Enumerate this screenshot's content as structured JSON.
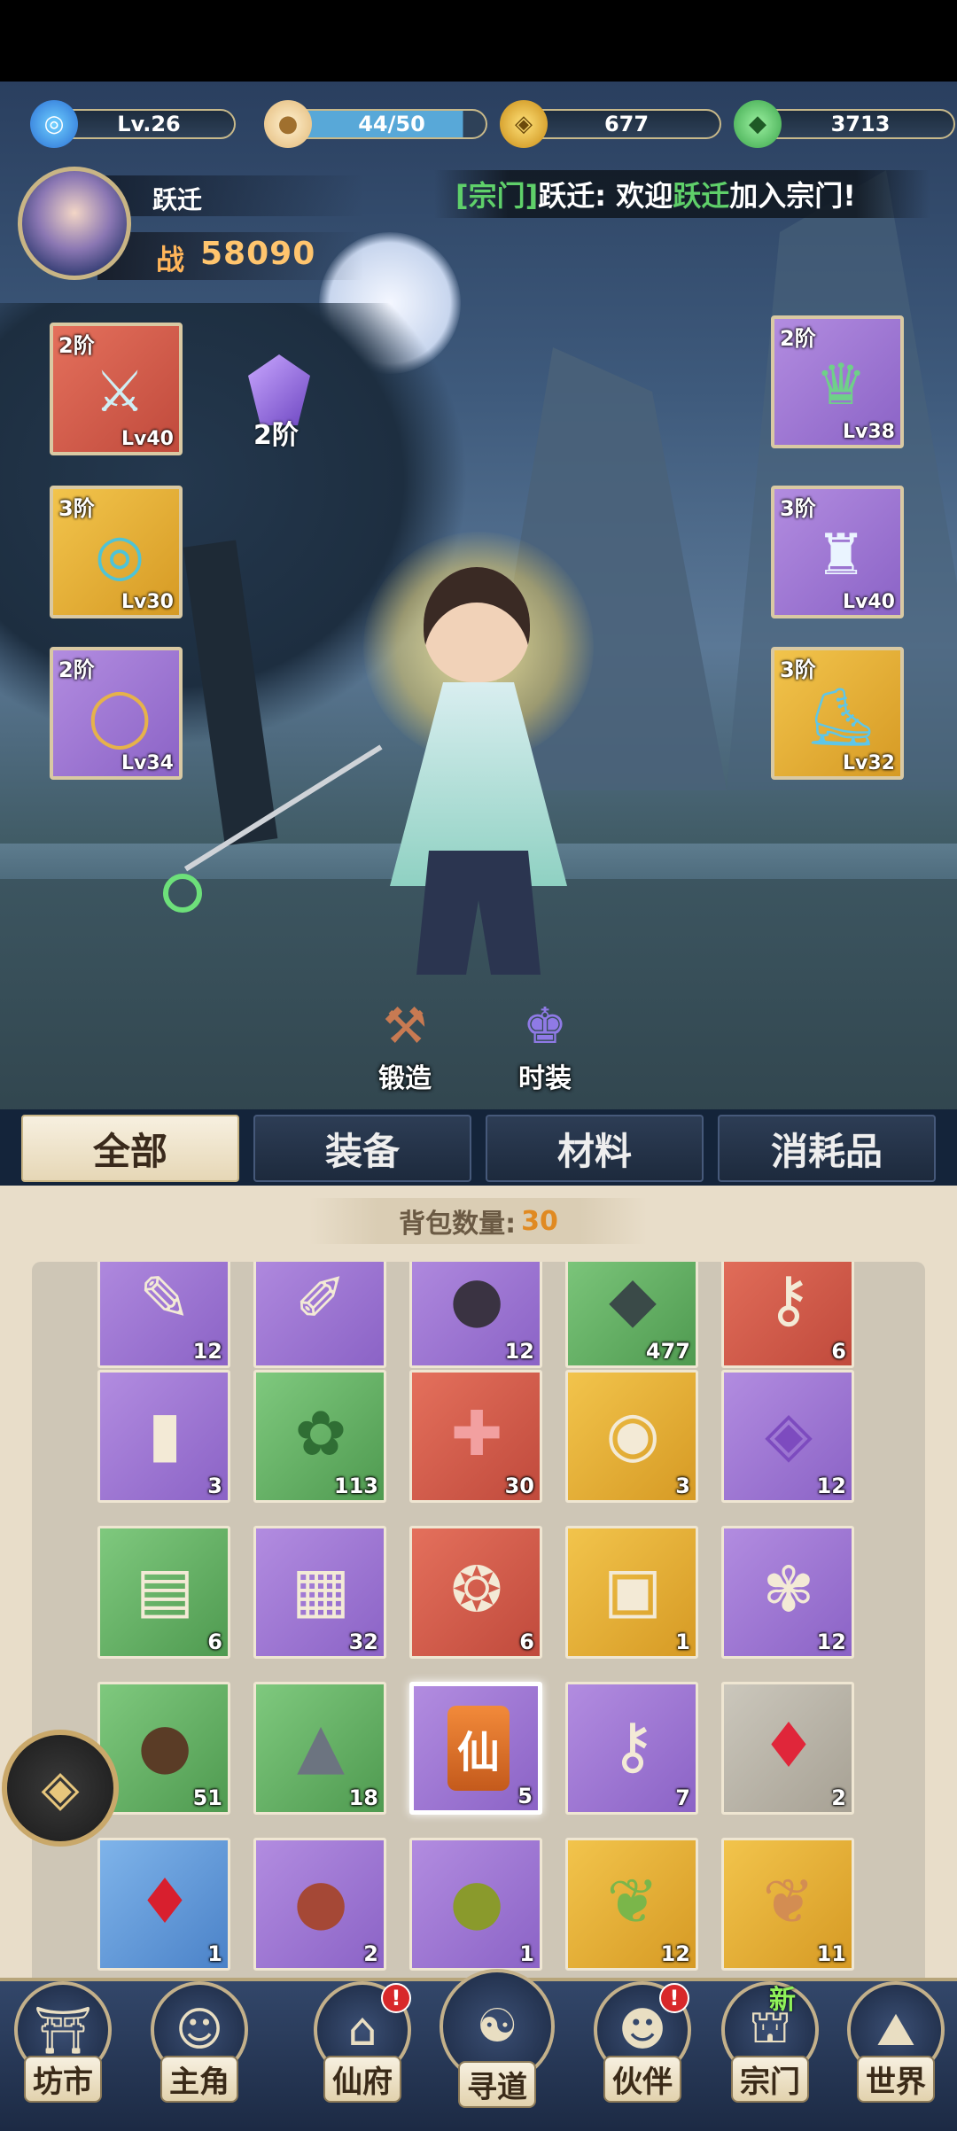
{
  "resources": {
    "level": "Lv.26",
    "stamina": "44/50",
    "coins": "677",
    "jade": "3713"
  },
  "player": {
    "name": "跃迁",
    "power_label": "战",
    "power": "58090"
  },
  "notice": {
    "tag": "[宗门]",
    "sender": "跃迁",
    "text_before": ": 欢迎",
    "name": "跃迁",
    "text_after": "加入宗门!"
  },
  "equipment": {
    "weapon": {
      "tier": "2阶",
      "level": "Lv40",
      "icon": "sword-icon",
      "color": "#d65c4a"
    },
    "amulet": {
      "tier": "3阶",
      "level": "Lv30",
      "icon": "jade-pendant-icon",
      "color": "#e6b238"
    },
    "ring": {
      "tier": "2阶",
      "level": "Lv34",
      "icon": "ring-icon",
      "color": "#9c74d4"
    },
    "helmet": {
      "tier": "2阶",
      "level": "Lv38",
      "icon": "helmet-icon",
      "color": "#9c74d4"
    },
    "armor": {
      "tier": "3阶",
      "level": "Lv40",
      "icon": "robe-icon",
      "color": "#9c74d4"
    },
    "boots": {
      "tier": "3阶",
      "level": "Lv32",
      "icon": "boots-icon",
      "color": "#e6b238"
    },
    "crystal_label": "2阶"
  },
  "actions": {
    "forge": "锻造",
    "fashion": "时装"
  },
  "tabs": [
    "全部",
    "装备",
    "材料",
    "消耗品"
  ],
  "bag": {
    "label": "背包数量:",
    "count": "30"
  },
  "items": [
    {
      "count": "12",
      "quality": "purple",
      "icon": "scroll-tool-icon"
    },
    {
      "count": "",
      "quality": "purple",
      "icon": "brush-icon"
    },
    {
      "count": "12",
      "quality": "purple",
      "icon": "ore-icon"
    },
    {
      "count": "477",
      "quality": "green",
      "icon": "stone-icon"
    },
    {
      "count": "6",
      "quality": "red",
      "icon": "key-icon"
    },
    {
      "count": "3",
      "quality": "purple",
      "icon": "scroll-icon"
    },
    {
      "count": "113",
      "quality": "green",
      "icon": "herb-ball-icon"
    },
    {
      "count": "30",
      "quality": "red",
      "icon": "puzzle-piece-icon"
    },
    {
      "count": "3",
      "quality": "gold",
      "icon": "drum-scroll-icon"
    },
    {
      "count": "12",
      "quality": "purple",
      "icon": "purple-gem-icon"
    },
    {
      "count": "6",
      "quality": "green",
      "icon": "parchment-icon"
    },
    {
      "count": "32",
      "quality": "purple",
      "icon": "book-icon"
    },
    {
      "count": "6",
      "quality": "red",
      "icon": "amulet-icon"
    },
    {
      "count": "1",
      "quality": "gold",
      "icon": "card-icon"
    },
    {
      "count": "12",
      "quality": "purple",
      "icon": "leaf-icon"
    },
    {
      "count": "51",
      "quality": "green",
      "icon": "seeds-icon"
    },
    {
      "count": "18",
      "quality": "green",
      "icon": "iron-ore-icon"
    },
    {
      "count": "5",
      "quality": "purple",
      "icon": "immortal-token-icon",
      "label": "仙"
    },
    {
      "count": "7",
      "quality": "purple",
      "icon": "silver-key-icon"
    },
    {
      "count": "2",
      "quality": "gray",
      "icon": "ruby-icon"
    },
    {
      "count": "1",
      "quality": "blue",
      "icon": "red-crystal-icon"
    },
    {
      "count": "2",
      "quality": "purple",
      "icon": "red-seed-icon"
    },
    {
      "count": "1",
      "quality": "purple",
      "icon": "green-seed-icon"
    },
    {
      "count": "12",
      "quality": "gold",
      "icon": "sprout-icon"
    },
    {
      "count": "11",
      "quality": "gold",
      "icon": "sprout-pod-icon"
    }
  ],
  "nav": [
    {
      "label": "坊市",
      "icon": "market-icon"
    },
    {
      "label": "主角",
      "icon": "hero-portrait-icon"
    },
    {
      "label": "仙府",
      "icon": "mansion-icon"
    },
    {
      "label": "寻道",
      "icon": "dao-icon"
    },
    {
      "label": "伙伴",
      "icon": "partner-icon"
    },
    {
      "label": "宗门",
      "icon": "sect-icon"
    },
    {
      "label": "世界",
      "icon": "world-icon"
    }
  ],
  "badges": {
    "alert": "!",
    "new": "新"
  }
}
